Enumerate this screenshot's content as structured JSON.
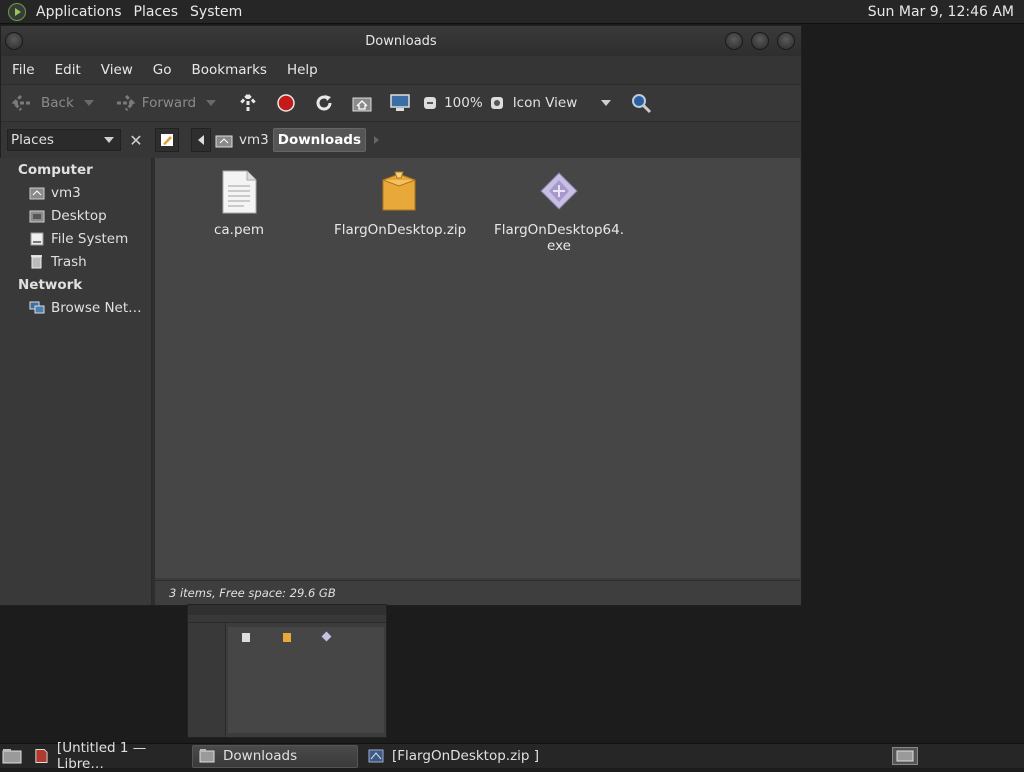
{
  "top_panel": {
    "menus": [
      "Applications",
      "Places",
      "System"
    ],
    "clock": "Sun Mar  9, 12:46 AM"
  },
  "window": {
    "title": "Downloads",
    "menubar": [
      "File",
      "Edit",
      "View",
      "Go",
      "Bookmarks",
      "Help"
    ],
    "toolbar": {
      "back_label": "Back",
      "forward_label": "Forward",
      "zoom_level": "100%",
      "view_mode": "Icon View"
    },
    "location": {
      "places_label": "Places",
      "crumbs": [
        "vm3",
        "Downloads"
      ]
    },
    "sidebar": {
      "sections": [
        {
          "title": "Computer",
          "items": [
            "vm3",
            "Desktop",
            "File System",
            "Trash"
          ]
        },
        {
          "title": "Network",
          "items": [
            "Browse Net…"
          ]
        }
      ]
    },
    "files": [
      {
        "name": "ca.pem",
        "icon": "text-file-icon"
      },
      {
        "name": "FlargOnDesktop.zip",
        "icon": "archive-icon"
      },
      {
        "name": "FlargOnDesktop64.\nexe",
        "icon": "executable-icon"
      }
    ],
    "status": "3 items, Free space: 29.6 GB"
  },
  "taskbar": {
    "tasks": [
      {
        "label": "[Untitled 1 — Libre…",
        "icon": "libreoffice-writer-icon",
        "active": false
      },
      {
        "label": "Downloads",
        "icon": "folder-icon",
        "active": true
      },
      {
        "label": "[FlargOnDesktop.zip ]",
        "icon": "archive-manager-icon",
        "active": false
      }
    ]
  },
  "colors": {
    "panel_bg": "#262626",
    "window_bg": "#3c3c3c",
    "content_bg": "#464646",
    "accent_green": "#8ccf50"
  }
}
